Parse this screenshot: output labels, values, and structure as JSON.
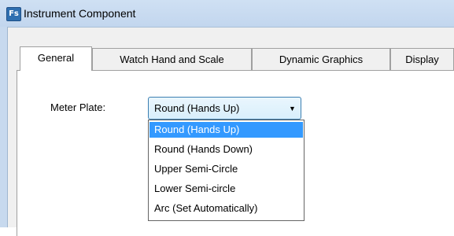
{
  "window": {
    "title": "Instrument Component",
    "icon": "fs-app-icon"
  },
  "tabs": [
    {
      "label": "General",
      "active": true
    },
    {
      "label": "Watch Hand and Scale",
      "active": false
    },
    {
      "label": "Dynamic Graphics",
      "active": false
    },
    {
      "label": "Display",
      "active": false
    }
  ],
  "meter_plate": {
    "label": "Meter Plate:",
    "selected": "Round (Hands Up)",
    "options": [
      "Round (Hands Up)",
      "Round (Hands Down)",
      "Upper Semi-Circle",
      "Lower Semi-circle",
      "Arc (Set Automatically)"
    ],
    "highlight_color": "#3399ff"
  }
}
